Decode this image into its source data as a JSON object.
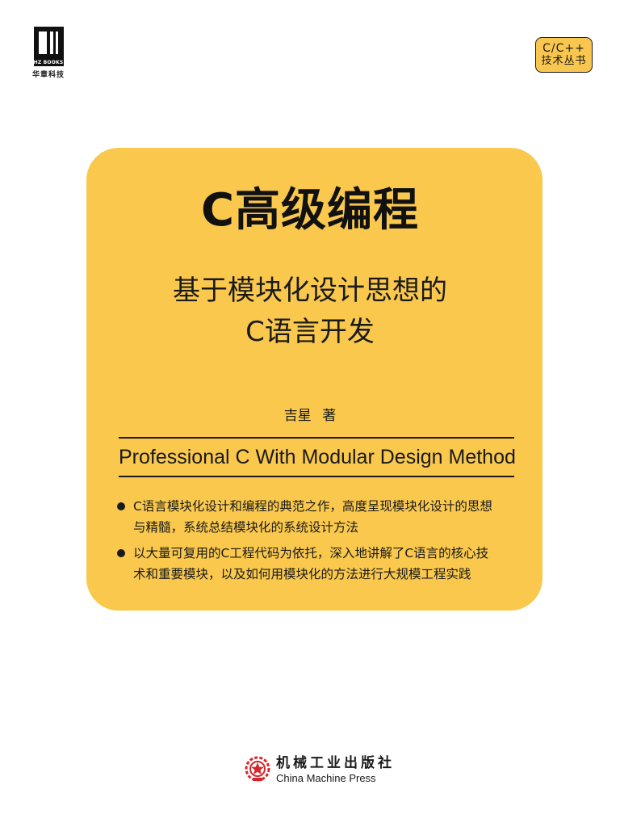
{
  "publisher_logo": {
    "brand": "HZ BOOKS",
    "name_cn": "华章科技"
  },
  "series": {
    "line1": "C/C++",
    "line2": "技术丛书"
  },
  "book": {
    "title": "C高级编程",
    "subtitle_line1": "基于模块化设计思想的",
    "subtitle_line2": "C语言开发",
    "author": "吉星 著",
    "english_title": "Professional C With Modular Design Method",
    "bullets": [
      {
        "line1": "C语言模块化设计和编程的典范之作，高度呈现模块化设计的思想",
        "line2": "与精髓，系统总结模块化的系统设计方法"
      },
      {
        "line1": "以大量可复用的C工程代码为依托，深入地讲解了C语言的核心技",
        "line2": "术和重要模块，以及如何用模块化的方法进行大规模工程实践"
      }
    ]
  },
  "publisher": {
    "name_cn": "机械工业出版社",
    "name_en": "China Machine Press"
  },
  "colors": {
    "panel": "#f9c84d",
    "text": "#1a1a1a",
    "logo_red": "#d7262b"
  }
}
